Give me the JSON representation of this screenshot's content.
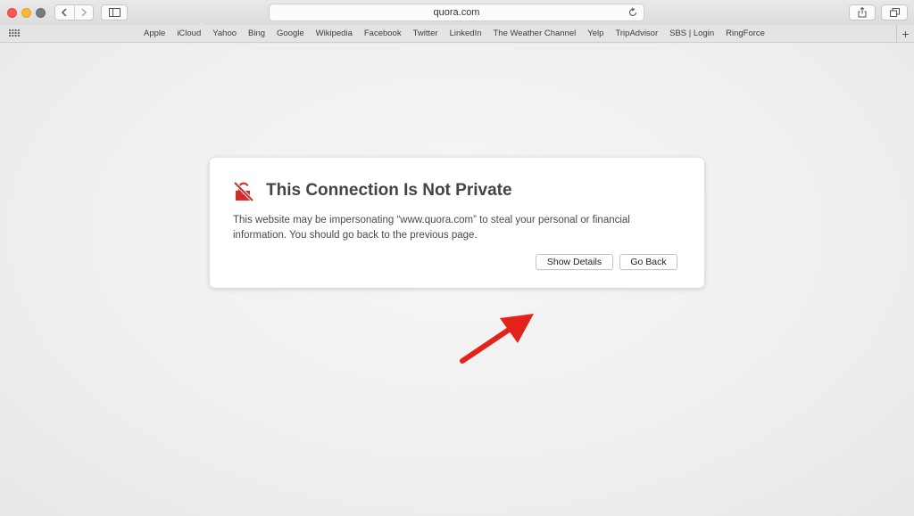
{
  "browser": {
    "url": "quora.com",
    "favorites": [
      "Apple",
      "iCloud",
      "Yahoo",
      "Bing",
      "Google",
      "Wikipedia",
      "Facebook",
      "Twitter",
      "LinkedIn",
      "The Weather Channel",
      "Yelp",
      "TripAdvisor",
      "SBS | Login",
      "RingForce"
    ],
    "add_label": "+"
  },
  "dialog": {
    "title": "This Connection Is Not Private",
    "description": "This website may be impersonating “www.quora.com” to steal your personal or financial information. You should go back to the previous page.",
    "show_details_label": "Show Details",
    "go_back_label": "Go Back",
    "icon": "broken-lock-icon"
  },
  "colors": {
    "warning_red": "#d42b2b",
    "arrow_red": "#e32219"
  }
}
